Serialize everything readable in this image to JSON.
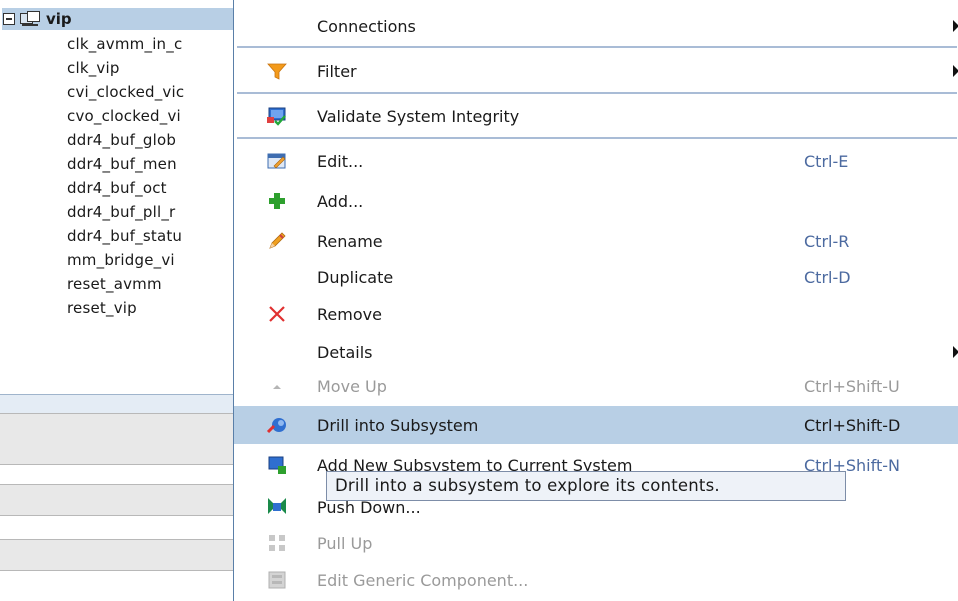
{
  "tree": {
    "root_label": "vip",
    "children": [
      "clk_avmm_in_c",
      "clk_vip",
      "cvi_clocked_vic",
      "cvo_clocked_vi",
      "ddr4_buf_glob",
      "ddr4_buf_men",
      "ddr4_buf_oct",
      "ddr4_buf_pll_r",
      "ddr4_buf_statu",
      "mm_bridge_vi",
      "reset_avmm",
      "reset_vip"
    ]
  },
  "menu": {
    "connections": {
      "label": "Connections"
    },
    "filter": {
      "label": "Filter",
      "icon": "filter-funnel-icon",
      "color": "#f39a1a"
    },
    "validate": {
      "label": "Validate System Integrity",
      "icon": "validate-system-icon"
    },
    "edit": {
      "label": "Edit...",
      "accelerator": "Ctrl-E",
      "icon": "edit-icon"
    },
    "add": {
      "label": "Add...",
      "icon": "plus-icon",
      "color": "#2ea02e"
    },
    "rename": {
      "label": "Rename",
      "accelerator": "Ctrl-R",
      "icon": "pencil-icon"
    },
    "duplicate": {
      "label": "Duplicate",
      "accelerator": "Ctrl-D"
    },
    "remove": {
      "label": "Remove",
      "icon": "remove-x-icon",
      "color": "#e03030"
    },
    "details": {
      "label": "Details"
    },
    "move_up": {
      "label": "Move Up",
      "accelerator": "Ctrl+Shift-U",
      "icon": "triangle-up-icon"
    },
    "drill_into": {
      "label": "Drill into Subsystem",
      "accelerator": "Ctrl+Shift-D",
      "icon": "drill-into-icon"
    },
    "add_subsystem": {
      "label": "Add New Subsystem to Current System",
      "accelerator": "Ctrl+Shift-N",
      "icon": "add-subsystem-icon"
    },
    "push_down": {
      "label": "Push Down...",
      "icon": "push-down-icon"
    },
    "pull_up": {
      "label": "Pull Up",
      "icon": "pull-up-icon"
    },
    "edit_generic": {
      "label": "Edit Generic Component...",
      "icon": "generic-component-icon"
    }
  },
  "tooltip": {
    "text": "Drill into a subsystem to explore its contents."
  },
  "colors": {
    "selection": "#b8cfe5",
    "accelerator": "#4c6aa0",
    "separator": "#a9bcd6"
  }
}
